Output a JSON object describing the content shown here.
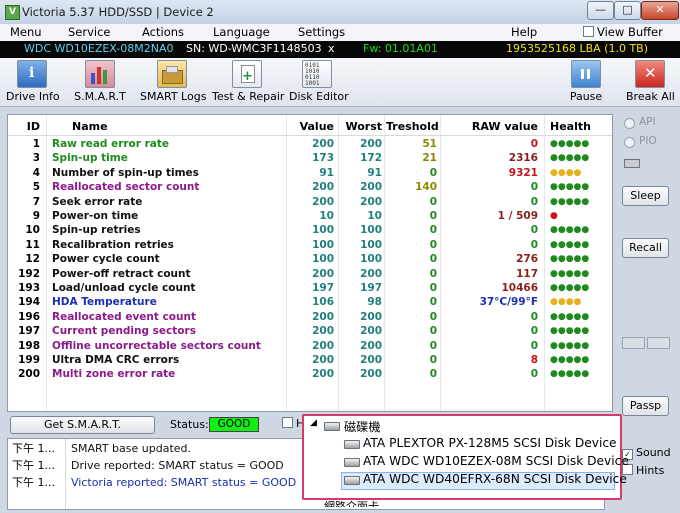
{
  "window": {
    "title": "Victoria 5.37 HDD/SSD | Device 2",
    "icon_label": "V"
  },
  "menu": {
    "items": [
      "Menu",
      "Service",
      "Actions",
      "Language",
      "Settings",
      "Help"
    ],
    "view_buffer": "View Buffer Live"
  },
  "drive_info": {
    "model": "WDC WD10EZEX-08M2NA0",
    "serial": "SN: WD-WMC3F1148503",
    "close_x": "x",
    "firmware": "Fw: 01.01A01",
    "capacity": "1953525168 LBA (1.0 TB)"
  },
  "toolbar": {
    "drive_info": "Drive Info",
    "smart": "S.M.A.R.T",
    "smart_logs": "SMART Logs",
    "test_repair": "Test & Repair",
    "disk_editor": "Disk Editor",
    "pause": "Pause",
    "break_all": "Break All"
  },
  "table": {
    "headers": {
      "id": "ID",
      "name": "Name",
      "value": "Value",
      "worst": "Worst",
      "treshold": "Treshold",
      "raw": "RAW value",
      "health": "Health"
    },
    "rows": [
      {
        "id": "1",
        "name": "Raw read error rate",
        "value": "200",
        "worst": "200",
        "treshold": "51",
        "raw": "0",
        "health": "●●●●●",
        "name_color": "#1e8a1e",
        "raw_color": "#c0161b",
        "health_color": "#1e8a1e",
        "tresh_color": "#8a8a00"
      },
      {
        "id": "3",
        "name": "Spin-up time",
        "value": "173",
        "worst": "172",
        "treshold": "21",
        "raw": "2316",
        "health": "●●●●●",
        "name_color": "#1e8a1e",
        "raw_color": "#8a1e1e",
        "health_color": "#1e8a1e",
        "tresh_color": "#8a8a00"
      },
      {
        "id": "4",
        "name": "Number of spin-up times",
        "value": "91",
        "worst": "91",
        "treshold": "0",
        "raw": "9321",
        "health": "●●●●",
        "name_color": "#111111",
        "raw_color": "#c0161b",
        "health_color": "#e3b21a",
        "tresh_color": "#1e8a1e"
      },
      {
        "id": "5",
        "name": "Reallocated sector count",
        "value": "200",
        "worst": "200",
        "treshold": "140",
        "raw": "0",
        "health": "●●●●●",
        "name_color": "#8b1a8b",
        "raw_color": "#1e8a1e",
        "health_color": "#1e8a1e",
        "tresh_color": "#8a8a00"
      },
      {
        "id": "7",
        "name": "Seek error rate",
        "value": "200",
        "worst": "200",
        "treshold": "0",
        "raw": "0",
        "health": "●●●●●",
        "name_color": "#111111",
        "raw_color": "#1e8a1e",
        "health_color": "#1e8a1e",
        "tresh_color": "#1e8a1e"
      },
      {
        "id": "9",
        "name": "Power-on time",
        "value": "10",
        "worst": "10",
        "treshold": "0",
        "raw": "1 / 509",
        "health": "●",
        "name_color": "#111111",
        "raw_color": "#8a1e1e",
        "health_color": "#d01010",
        "tresh_color": "#1e8a1e"
      },
      {
        "id": "10",
        "name": "Spin-up retries",
        "value": "100",
        "worst": "100",
        "treshold": "0",
        "raw": "0",
        "health": "●●●●●",
        "name_color": "#111111",
        "raw_color": "#1e8a1e",
        "health_color": "#1e8a1e",
        "tresh_color": "#1e8a1e"
      },
      {
        "id": "11",
        "name": "Recalibration retries",
        "value": "100",
        "worst": "100",
        "treshold": "0",
        "raw": "0",
        "health": "●●●●●",
        "name_color": "#111111",
        "raw_color": "#1e8a1e",
        "health_color": "#1e8a1e",
        "tresh_color": "#1e8a1e"
      },
      {
        "id": "12",
        "name": "Power cycle count",
        "value": "100",
        "worst": "100",
        "treshold": "0",
        "raw": "276",
        "health": "●●●●●",
        "name_color": "#111111",
        "raw_color": "#8a1e1e",
        "health_color": "#1e8a1e",
        "tresh_color": "#1e8a1e"
      },
      {
        "id": "192",
        "name": "Power-off retract count",
        "value": "200",
        "worst": "200",
        "treshold": "0",
        "raw": "117",
        "health": "●●●●●",
        "name_color": "#111111",
        "raw_color": "#8a1e1e",
        "health_color": "#1e8a1e",
        "tresh_color": "#1e8a1e"
      },
      {
        "id": "193",
        "name": "Load/unload cycle count",
        "value": "197",
        "worst": "197",
        "treshold": "0",
        "raw": "10466",
        "health": "●●●●●",
        "name_color": "#111111",
        "raw_color": "#8a1e1e",
        "health_color": "#1e8a1e",
        "tresh_color": "#1e8a1e"
      },
      {
        "id": "194",
        "name": "HDA Temperature",
        "value": "106",
        "worst": "98",
        "treshold": "0",
        "raw": "37°C/99°F",
        "health": "●●●●",
        "name_color": "#1a2fb0",
        "raw_color": "#1a2fb0",
        "health_color": "#e3b21a",
        "tresh_color": "#1e8a1e"
      },
      {
        "id": "196",
        "name": "Reallocated event count",
        "value": "200",
        "worst": "200",
        "treshold": "0",
        "raw": "0",
        "health": "●●●●●",
        "name_color": "#8b1a8b",
        "raw_color": "#1e8a1e",
        "health_color": "#1e8a1e",
        "tresh_color": "#1e8a1e"
      },
      {
        "id": "197",
        "name": "Current pending sectors",
        "value": "200",
        "worst": "200",
        "treshold": "0",
        "raw": "0",
        "health": "●●●●●",
        "name_color": "#8b1a8b",
        "raw_color": "#1e8a1e",
        "health_color": "#1e8a1e",
        "tresh_color": "#1e8a1e"
      },
      {
        "id": "198",
        "name": "Offline uncorrectable sectors count",
        "value": "200",
        "worst": "200",
        "treshold": "0",
        "raw": "0",
        "health": "●●●●●",
        "name_color": "#8b1a8b",
        "raw_color": "#1e8a1e",
        "health_color": "#1e8a1e",
        "tresh_color": "#1e8a1e"
      },
      {
        "id": "199",
        "name": "Ultra DMA CRC errors",
        "value": "200",
        "worst": "200",
        "treshold": "0",
        "raw": "8",
        "health": "●●●●●",
        "name_color": "#111111",
        "raw_color": "#d01010",
        "health_color": "#1e8a1e",
        "tresh_color": "#1e8a1e"
      },
      {
        "id": "200",
        "name": "Multi zone error rate",
        "value": "200",
        "worst": "200",
        "treshold": "0",
        "raw": "0",
        "health": "●●●●●",
        "name_color": "#8b1a8b",
        "raw_color": "#1e8a1e",
        "health_color": "#1e8a1e",
        "tresh_color": "#1e8a1e"
      }
    ]
  },
  "right_panel": {
    "api": "API",
    "pio": "PIO",
    "sleep": "Sleep",
    "recall": "Recall",
    "passp": "Passp",
    "sound": "Sound",
    "hints": "Hints"
  },
  "status_row": {
    "get_smart": "Get S.M.A.R.T.",
    "status_label": "Status:",
    "status_value": "GOOD",
    "status_color": "#13ee13",
    "checkbox_label": "H"
  },
  "log": [
    {
      "time": "下午 1...",
      "message": "SMART base updated.",
      "color": "#111111"
    },
    {
      "time": "下午 1...",
      "message": "Drive reported: SMART status = GOOD",
      "color": "#111111"
    },
    {
      "time": "下午 1...",
      "message": "Victoria reported: SMART status = GOOD",
      "color": "#1a2fb0"
    }
  ],
  "popup": {
    "group_label": "磁碟機",
    "devices": [
      "ATA PLEXTOR PX-128M5 SCSI Disk Device",
      "ATA WDC WD10EZEX-08M SCSI Disk Device",
      "ATA WDC WD40EFRX-68N SCSI Disk Device"
    ],
    "next_group": "網路介面卡"
  }
}
